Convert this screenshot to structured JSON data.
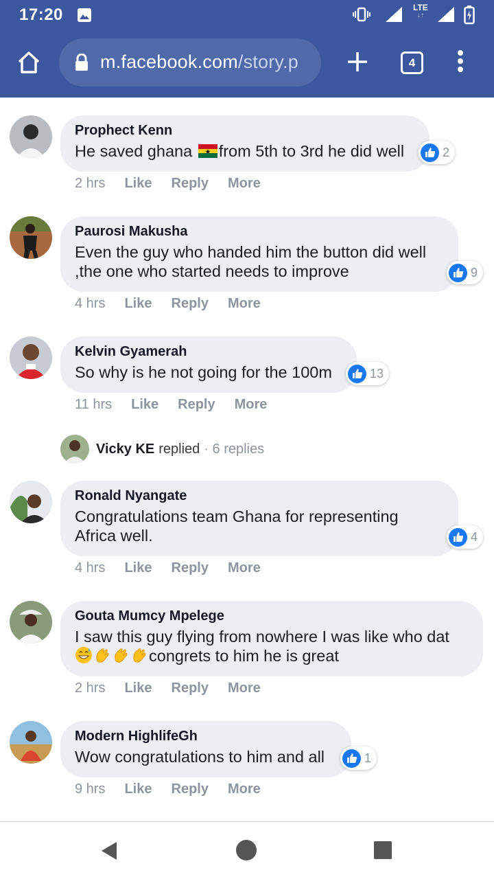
{
  "statusbar": {
    "time": "17:20",
    "network": "LTE",
    "icons": [
      "image-icon",
      "vibrate-icon",
      "signal-icon",
      "lte-signal-icon",
      "battery-icon"
    ]
  },
  "browser": {
    "url_main": "m.facebook.com",
    "url_path": "/story.p",
    "tab_count": "4"
  },
  "comments": [
    {
      "author": "Prophect Kenn",
      "text_before": "He saved ghana ",
      "text_after": "from 5th to 3rd he did well",
      "reactions": "2",
      "time": "2 hrs"
    },
    {
      "author": "Paurosi Makusha",
      "text": "Even the guy who handed him the button did well\n,the one who started needs to improve",
      "reactions": "9",
      "time": "4 hrs"
    },
    {
      "author": "Kelvin Gyamerah",
      "text": "So why is he not going for the 100m",
      "reactions": "13",
      "time": "11 hrs",
      "replies": {
        "name": "Vicky KE",
        "verb": "replied",
        "count": "· 6 replies"
      }
    },
    {
      "author": "Ronald Nyangate",
      "text": "Congratulations team Ghana for representing\nAfrica well.",
      "reactions": "4",
      "time": "4 hrs"
    },
    {
      "author": "Gouta Mumcy Mpelege",
      "text_line1": "I saw this guy flying from nowhere I was like who dat",
      "text_line2": "congrets to him he is great",
      "time": "2 hrs"
    },
    {
      "author": "Modern HighlifeGh",
      "text": "Wow congratulations to him and all",
      "reactions": "1",
      "time": "9 hrs"
    }
  ],
  "actions": {
    "like": "Like",
    "reply": "Reply",
    "more": "More"
  },
  "colors": {
    "facebook_blue": "#3b579d",
    "like_blue": "#1877f2",
    "bubble": "#eceef2",
    "meta_gray": "#8d949e"
  }
}
